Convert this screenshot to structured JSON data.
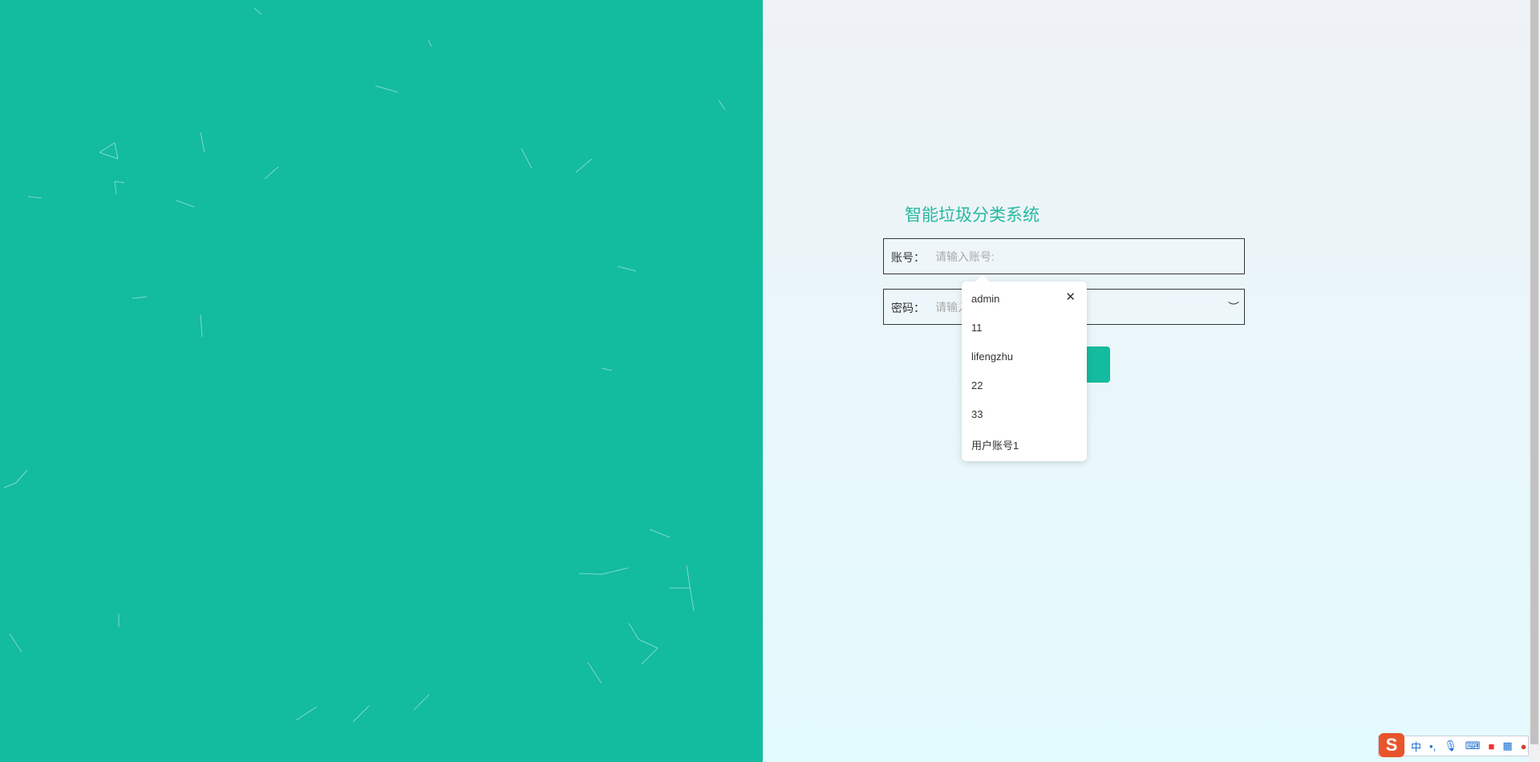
{
  "colors": {
    "brand": "#13bb9f",
    "title": "#27b89f"
  },
  "title": "智能垃圾分类系统",
  "account": {
    "label": "账号：",
    "placeholder": "请输入账号:"
  },
  "password": {
    "label": "密码：",
    "placeholder": "请输入密码:",
    "eye_icon": "eye-closed-icon"
  },
  "autocomplete": {
    "items": [
      "admin",
      "11",
      "lifengzhu",
      "22",
      "33",
      "用户账号1"
    ],
    "close": "✕"
  },
  "ime": {
    "logo": "S",
    "mode": "中",
    "punct": "•,",
    "icons": [
      "mic-icon",
      "keyboard-icon",
      "skin-icon",
      "apps-icon",
      "toolbox-icon"
    ]
  }
}
